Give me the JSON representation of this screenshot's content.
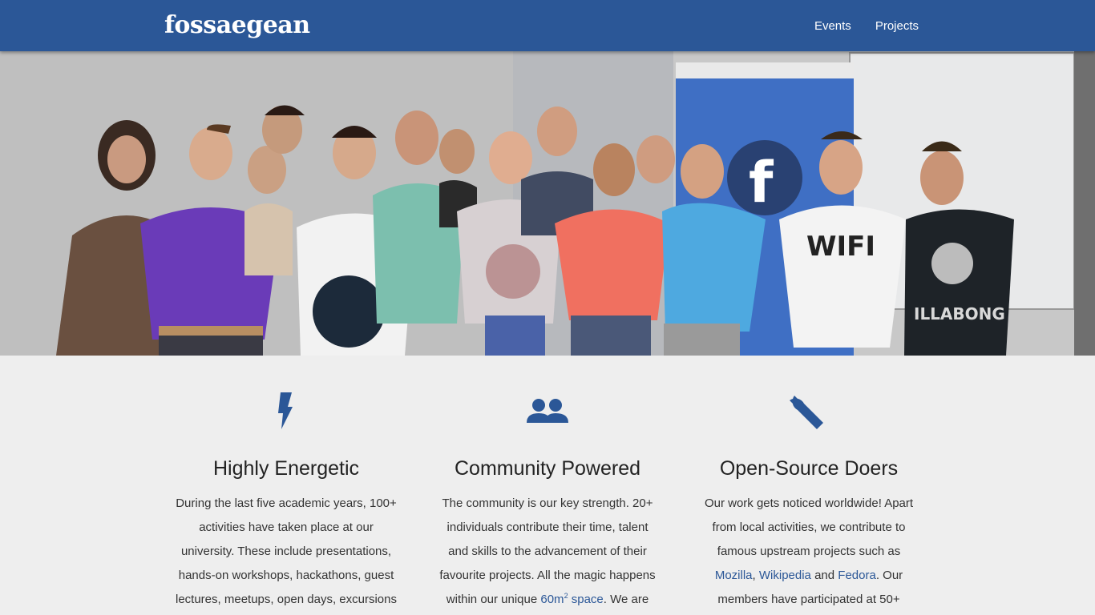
{
  "nav": {
    "brand": "fossaegean",
    "links": [
      "Events",
      "Projects"
    ]
  },
  "hero": {
    "icon": "fedora-logo"
  },
  "features": [
    {
      "icon": "lightning-bolt-icon",
      "title": "Highly Energetic",
      "text": "During the last five academic years, 100+ activities have taken place at our university. These include presentations, hands-on workshops, hackathons, guest lectures, meetups, open days, excursions"
    },
    {
      "icon": "people-group-icon",
      "title": "Community Powered",
      "text_before": "The community is our key strength. 20+ individuals contribute their time, talent and skills to the advancement of their favourite projects. All the magic happens within our unique ",
      "link_60": "60m",
      "link_sup": "2",
      "link_space": " space",
      "text_after": ". We are"
    },
    {
      "icon": "wrench-icon",
      "title": "Open-Source Doers",
      "text_before": "Our work gets noticed worldwide! Apart from local activities, we contribute to famous upstream projects such as ",
      "link_mozilla": "Mozilla",
      "sep": ", ",
      "link_wikipedia": "Wikipedia",
      "and": " and ",
      "link_fedora": "Fedora",
      "text_after": ". Our members have participated at 50+"
    }
  ],
  "colors": {
    "navbar": "#2b5797",
    "accent": "#2b5797",
    "background": "#eeeeee"
  }
}
